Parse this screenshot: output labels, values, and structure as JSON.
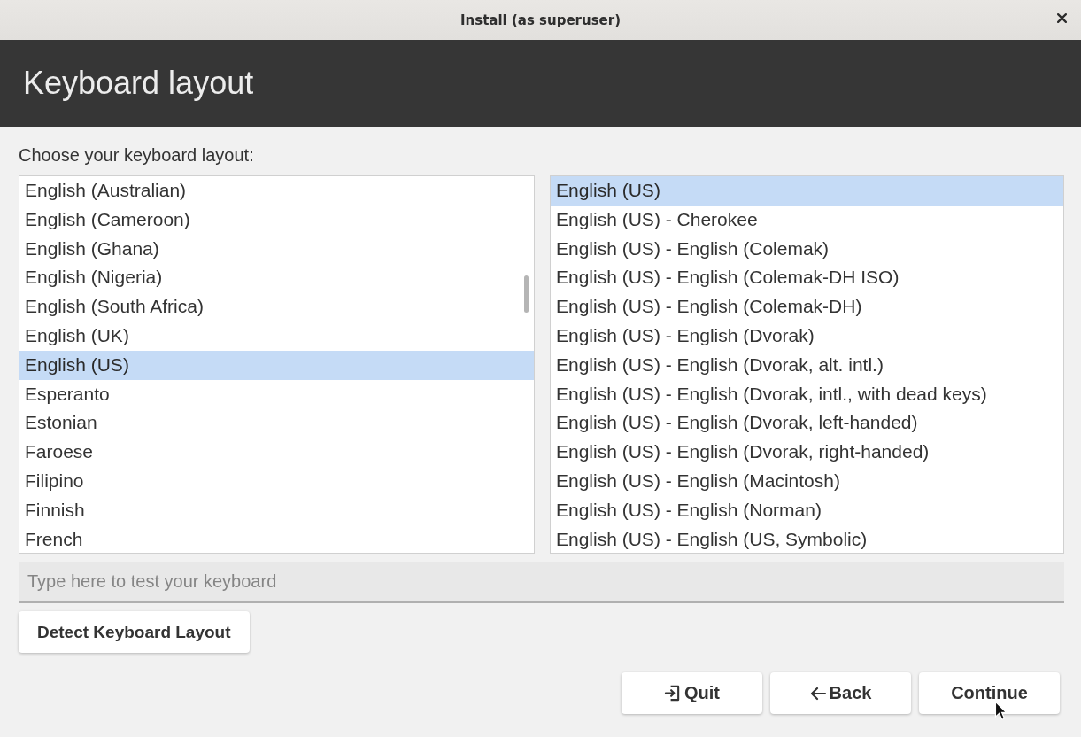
{
  "window": {
    "title": "Install (as superuser)"
  },
  "header": {
    "title": "Keyboard layout"
  },
  "prompt": "Choose your keyboard layout:",
  "layouts": [
    {
      "label": "English (Australian)",
      "selected": false
    },
    {
      "label": "English (Cameroon)",
      "selected": false
    },
    {
      "label": "English (Ghana)",
      "selected": false
    },
    {
      "label": "English (Nigeria)",
      "selected": false
    },
    {
      "label": "English (South Africa)",
      "selected": false
    },
    {
      "label": "English (UK)",
      "selected": false
    },
    {
      "label": "English (US)",
      "selected": true
    },
    {
      "label": "Esperanto",
      "selected": false
    },
    {
      "label": "Estonian",
      "selected": false
    },
    {
      "label": "Faroese",
      "selected": false
    },
    {
      "label": "Filipino",
      "selected": false
    },
    {
      "label": "Finnish",
      "selected": false
    },
    {
      "label": "French",
      "selected": false
    }
  ],
  "variants": [
    {
      "label": "English (US)",
      "selected": true
    },
    {
      "label": "English (US) - Cherokee",
      "selected": false
    },
    {
      "label": "English (US) - English (Colemak)",
      "selected": false
    },
    {
      "label": "English (US) - English (Colemak-DH ISO)",
      "selected": false
    },
    {
      "label": "English (US) - English (Colemak-DH)",
      "selected": false
    },
    {
      "label": "English (US) - English (Dvorak)",
      "selected": false
    },
    {
      "label": "English (US) - English (Dvorak, alt. intl.)",
      "selected": false
    },
    {
      "label": "English (US) - English (Dvorak, intl., with dead keys)",
      "selected": false
    },
    {
      "label": "English (US) - English (Dvorak, left-handed)",
      "selected": false
    },
    {
      "label": "English (US) - English (Dvorak, right-handed)",
      "selected": false
    },
    {
      "label": "English (US) - English (Macintosh)",
      "selected": false
    },
    {
      "label": "English (US) - English (Norman)",
      "selected": false
    },
    {
      "label": "English (US) - English (US, Symbolic)",
      "selected": false
    }
  ],
  "test_field": {
    "placeholder": "Type here to test your keyboard"
  },
  "detect_button": "Detect Keyboard Layout",
  "buttons": [
    {
      "kind": "quit",
      "label": "Quit"
    },
    {
      "kind": "back",
      "label": "Back"
    },
    {
      "kind": "continue",
      "label": "Continue"
    }
  ]
}
